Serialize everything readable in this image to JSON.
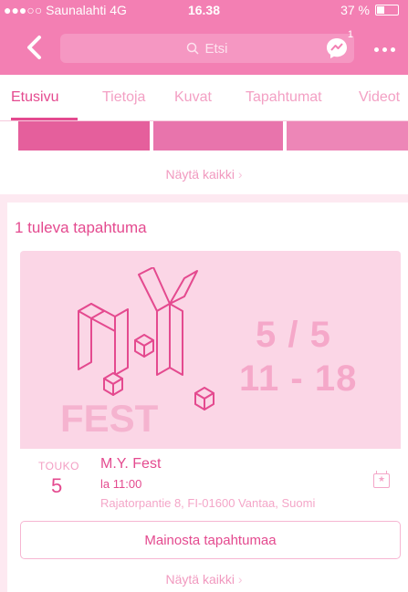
{
  "status_bar": {
    "carrier": "●●●○○ Saunalahti  4G",
    "time": "16.38",
    "battery": "37 %"
  },
  "nav": {
    "search_placeholder": "Etsi",
    "messenger_badge": "1"
  },
  "tabs": [
    {
      "label": "Etusivu",
      "active": true
    },
    {
      "label": "Tietoja"
    },
    {
      "label": "Kuvat"
    },
    {
      "label": "Tapahtumat"
    },
    {
      "label": "Videot"
    }
  ],
  "photos": {
    "see_all": "Näytä kaikki"
  },
  "events": {
    "title": "1 tuleva tapahtuma",
    "banner": {
      "logo_text": "FEST",
      "date_line1": "5 / 5",
      "date_line2": "11 - 18"
    },
    "event": {
      "month": "TOUKO",
      "day": "5",
      "name": "M.Y. Fest",
      "time": "la 11:00",
      "address": "Rajatorpantie 8, FI-01600 Vantaa, Suomi"
    },
    "promote_label": "Mainosta tapahtumaa",
    "see_all": "Näytä kaikki"
  },
  "colors": {
    "accent": "#e44a8f",
    "nav": "#f37fb3",
    "banner_bg": "#fbd6e6"
  }
}
